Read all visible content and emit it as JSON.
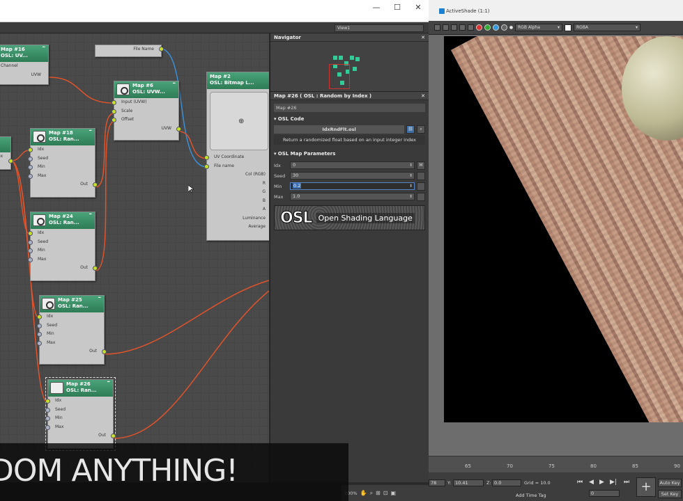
{
  "window": {
    "minimize": "—",
    "maximize": "☐",
    "close": "✕"
  },
  "editor": {
    "view_select": "View1"
  },
  "nodes": {
    "map16": {
      "title": "Map #16",
      "subtitle": "OSL: UV...",
      "rows": [
        "Channel",
        "UVW"
      ]
    },
    "partial": {
      "rows": [
        "ex"
      ]
    },
    "filename_stub": {
      "rows": [
        "File Name"
      ]
    },
    "map6": {
      "title": "Map #6",
      "subtitle": "OSL: UVW...",
      "rows": [
        "Input (UVW)",
        "Scale",
        "Offset",
        "UVW"
      ]
    },
    "map2": {
      "title": "Map #2",
      "subtitle": "OSL: Bitmap L...",
      "rows": [
        "UV Coordinate",
        "File name",
        "Col (RGB)",
        "R",
        "G",
        "B",
        "A",
        "Luminance",
        "Average"
      ]
    },
    "map18": {
      "title": "Map #18",
      "subtitle": "OSL: Ran...",
      "rows": [
        "Idx",
        "Seed",
        "Min",
        "Max",
        "Out"
      ]
    },
    "map24": {
      "title": "Map #24",
      "subtitle": "OSL: Ran...",
      "rows": [
        "Idx",
        "Seed",
        "Min",
        "Max",
        "Out"
      ]
    },
    "map25": {
      "title": "Map #25",
      "subtitle": "OSL: Ran...",
      "rows": [
        "Idx",
        "Seed",
        "Min",
        "Max",
        "Out"
      ]
    },
    "map26": {
      "title": "Map #26",
      "subtitle": "OSL: Ran...",
      "rows": [
        "Idx",
        "Seed",
        "Min",
        "Max",
        "Out"
      ]
    }
  },
  "navigator": {
    "title": "Navigator",
    "close": "✕"
  },
  "params": {
    "title": "Map #26  ( OSL : Random by Index )",
    "map_name": "Map #26",
    "osl_code_section": "OSL Code",
    "file_name": "IdxRndFlt.osl",
    "description": "Return a randomized float based on an input integer index",
    "map_params_section": "OSL Map Parameters",
    "fields": [
      {
        "label": "Idx",
        "value": "0"
      },
      {
        "label": "Seed",
        "value": "30"
      },
      {
        "label": "Min",
        "value": "0.2"
      },
      {
        "label": "Max",
        "value": "1.0"
      }
    ],
    "map_button": "M",
    "logo_mark": "OSL",
    "logo_text": "Open Shading Language"
  },
  "activeshade": {
    "title": "ActiveShade (1:1)",
    "channel": "RGB Alpha",
    "display": "RGBA"
  },
  "timeline": {
    "ticks": [
      "65",
      "70",
      "75",
      "80",
      "85",
      "90"
    ]
  },
  "status": {
    "x_partial": "78",
    "y_label": "Y:",
    "y_value": "10.41",
    "z_label": "Z:",
    "z_value": "0.0",
    "grid": "Grid = 10.0",
    "add_time_tag": "Add Time Tag",
    "frame": "0",
    "auto_key": "Auto Key",
    "set_key": "Set Key",
    "zoom": "100%"
  },
  "banner": {
    "text": "DOM ANYTHING!"
  },
  "colors": {
    "node_header": "#3a9068",
    "port": "#c7e02a",
    "wire_orange": "#e0532b",
    "wire_blue": "#3b8fd6"
  }
}
